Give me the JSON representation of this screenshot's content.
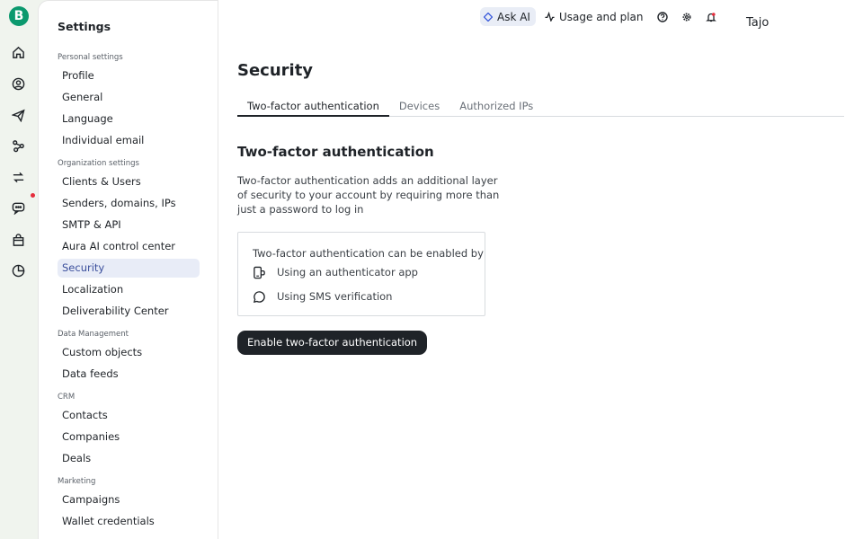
{
  "brand": {
    "logo_letter": "B",
    "accent": "#0b996e"
  },
  "rail": {
    "icons": [
      "home-icon",
      "contacts-icon",
      "campaigns-icon",
      "automations-icon",
      "workflows-icon",
      "conversations-icon",
      "commerce-icon",
      "reports-icon"
    ]
  },
  "settings": {
    "title": "Settings",
    "sections": [
      {
        "label": "Personal settings",
        "items": [
          "Profile",
          "General",
          "Language",
          "Individual email"
        ]
      },
      {
        "label": "Organization settings",
        "items": [
          "Clients & Users",
          "Senders, domains, IPs",
          "SMTP & API",
          "Aura AI control center",
          "Security",
          "Localization",
          "Deliverability Center"
        ]
      },
      {
        "label": "Data Management",
        "items": [
          "Custom objects",
          "Data feeds"
        ]
      },
      {
        "label": "CRM",
        "items": [
          "Contacts",
          "Companies",
          "Deals"
        ]
      },
      {
        "label": "Marketing",
        "items": [
          "Campaigns",
          "Wallet credentials"
        ]
      }
    ],
    "active_item": "Security"
  },
  "topbar": {
    "ask_ai": "Ask AI",
    "usage": "Usage and plan",
    "user": "Tajo"
  },
  "page": {
    "title": "Security",
    "tabs": [
      "Two-factor authentication",
      "Devices",
      "Authorized IPs"
    ],
    "active_tab": 0,
    "section_title": "Two-factor authentication",
    "description": "Two-factor authentication adds an additional layer of security to your account by requiring more than just a password to log in",
    "info_heading": "Two-factor authentication can be enabled by",
    "methods": [
      "Using an authenticator app",
      "Using SMS verification"
    ],
    "enable_button": "Enable two-factor authentication"
  }
}
